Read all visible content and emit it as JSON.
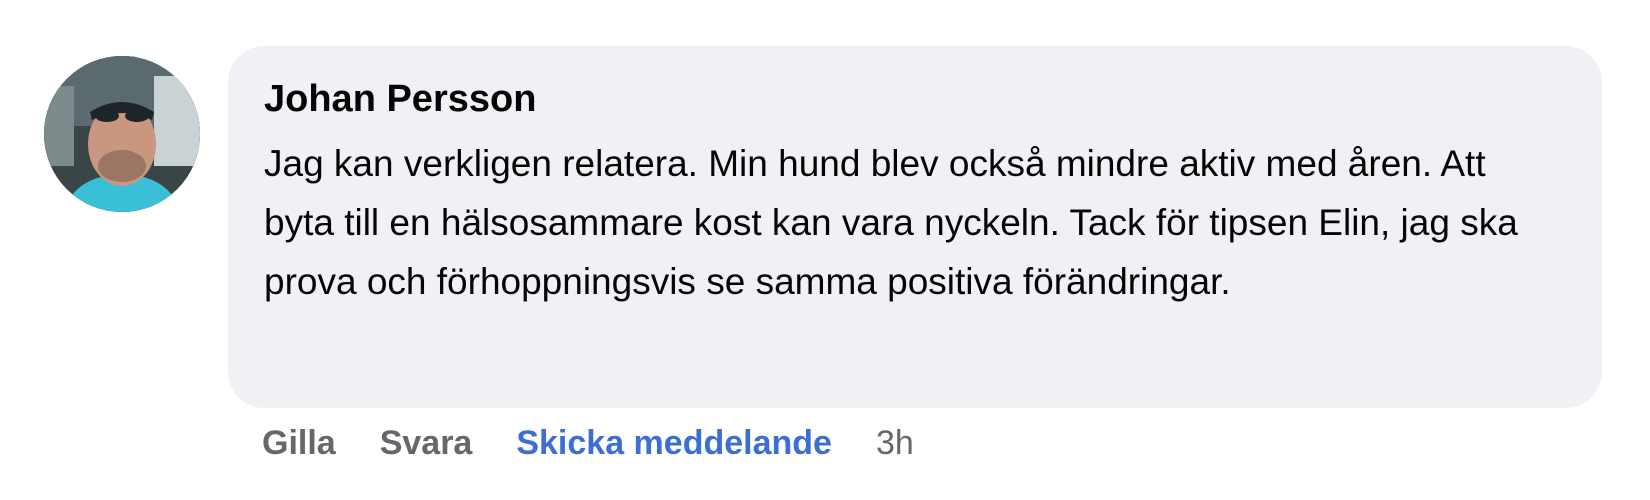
{
  "comment": {
    "author": "Johan Persson",
    "text": "Jag kan verkligen relatera. Min hund blev också mindre aktiv med åren. Att byta till en hälsosammare kost kan vara nyckeln. Tack för tipsen Elin, jag ska prova och förhoppningsvis se samma positiva förändringar.",
    "avatar_icon": "user-profile-photo"
  },
  "actions": {
    "like_label": "Gilla",
    "reply_label": "Svara",
    "message_label": "Skicka meddelande",
    "timestamp": "3h"
  },
  "colors": {
    "bubble_background": "#f0f1f5",
    "action_gray": "#65676b",
    "link_blue": "#3c6ed4",
    "text": "#050505"
  }
}
